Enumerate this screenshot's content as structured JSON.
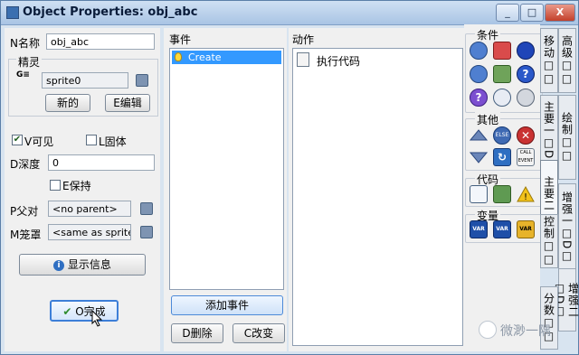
{
  "window": {
    "title": "Object Properties: obj_abc",
    "btn_min": "_",
    "btn_max": "□",
    "btn_close": "X"
  },
  "props": {
    "name_label": "N名称",
    "name_value": "obj_abc",
    "sprite_group": "精灵",
    "sprite_value": "sprite0",
    "new_button": "新的",
    "edit_button": "E编辑",
    "visible_label": "V可见",
    "visible_check": "✔",
    "solid_label": "L固体",
    "depth_label": "D深度",
    "depth_value": "0",
    "persistent_label": "E保持",
    "parent_label": "P父对",
    "parent_value": "<no parent>",
    "mask_label": "M笼罩",
    "mask_value": "<same as sprite>",
    "show_info_button": "显示信息",
    "info_icon": "i",
    "ok_button": "O完成",
    "ok_check": "✔"
  },
  "events": {
    "header": "事件",
    "items": [
      {
        "label": "Create"
      }
    ],
    "add_button": "添加事件",
    "delete_button": "D删除",
    "change_button": "C改变"
  },
  "actions": {
    "header": "动作",
    "items": [
      {
        "label": "执行代码"
      }
    ]
  },
  "palette": {
    "groups": [
      "条件",
      "其他",
      "代码",
      "变量"
    ],
    "other_labels": [
      "ELSE",
      "CALL EVENT"
    ],
    "var_label": "VAR",
    "tabs": [
      "高级□□",
      "移动□□",
      "主要一□D□",
      "绘制□□",
      "主要二□D□",
      "增强一□D□",
      "控制□□",
      "增强二□D□",
      "分数□□"
    ]
  },
  "watermark": "微渺一隅",
  "colors": {
    "title_bar": "#a9c4e4",
    "selection": "#3399ff",
    "var_gold": "#e7b32a"
  }
}
